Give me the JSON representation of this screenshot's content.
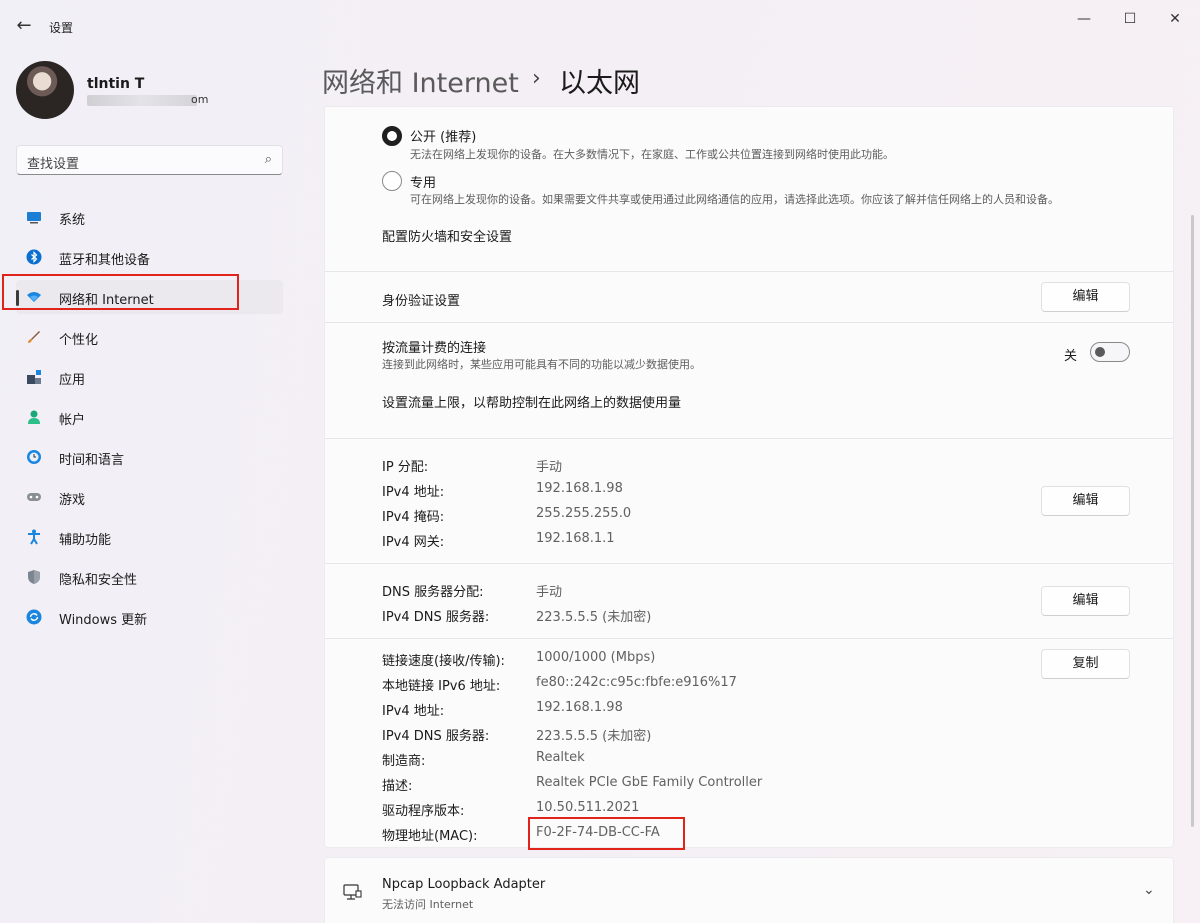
{
  "window": {
    "title": "设置",
    "minimize_glyph": "—",
    "maximize_glyph": "☐",
    "close_glyph": "✕"
  },
  "account": {
    "name": "tlntin T",
    "email_suffix": "om"
  },
  "search": {
    "placeholder": "查找设置"
  },
  "sidebar": {
    "items": [
      {
        "label": "系统",
        "icon": "system-icon"
      },
      {
        "label": "蓝牙和其他设备",
        "icon": "bluetooth-icon"
      },
      {
        "label": "网络和 Internet",
        "icon": "network-icon",
        "active": true
      },
      {
        "label": "个性化",
        "icon": "personalization-icon"
      },
      {
        "label": "应用",
        "icon": "apps-icon"
      },
      {
        "label": "帐户",
        "icon": "accounts-icon"
      },
      {
        "label": "时间和语言",
        "icon": "time-language-icon"
      },
      {
        "label": "游戏",
        "icon": "gaming-icon"
      },
      {
        "label": "辅助功能",
        "icon": "accessibility-icon"
      },
      {
        "label": "隐私和安全性",
        "icon": "privacy-icon"
      },
      {
        "label": "Windows 更新",
        "icon": "windows-update-icon"
      }
    ]
  },
  "header": {
    "parent": "网络和 Internet",
    "separator": "›",
    "current": "以太网"
  },
  "profile": {
    "public": {
      "label": "公开 (推荐)",
      "desc": "无法在网络上发现你的设备。在大多数情况下，在家庭、工作或公共位置连接到网络时使用此功能。",
      "selected": true
    },
    "private": {
      "label": "专用",
      "desc": "可在网络上发现你的设备。如果需要文件共享或使用通过此网络通信的应用，请选择此选项。你应该了解并信任网络上的人员和设备。",
      "selected": false
    },
    "firewall_link": "配置防火墙和安全设置"
  },
  "auth": {
    "label": "身份验证设置",
    "button": "编辑"
  },
  "metered": {
    "label": "按流量计费的连接",
    "desc": "连接到此网络时，某些应用可能具有不同的功能以减少数据使用。",
    "state": "关",
    "enabled": false,
    "limit_link": "设置流量上限，以帮助控制在此网络上的数据使用量"
  },
  "ip": {
    "button": "编辑",
    "rows": [
      {
        "label": "IP 分配:",
        "value": "手动"
      },
      {
        "label": "IPv4 地址:",
        "value": "192.168.1.98"
      },
      {
        "label": "IPv4 掩码:",
        "value": "255.255.255.0"
      },
      {
        "label": "IPv4 网关:",
        "value": "192.168.1.1"
      }
    ]
  },
  "dns": {
    "button": "编辑",
    "rows": [
      {
        "label": "DNS 服务器分配:",
        "value": "手动"
      },
      {
        "label": "IPv4 DNS 服务器:",
        "value": "223.5.5.5 (未加密)"
      }
    ]
  },
  "properties": {
    "button": "复制",
    "rows": [
      {
        "label": "链接速度(接收/传输):",
        "value": "1000/1000 (Mbps)"
      },
      {
        "label": "本地链接 IPv6 地址:",
        "value": "fe80::242c:c95c:fbfe:e916%17"
      },
      {
        "label": "IPv4 地址:",
        "value": "192.168.1.98"
      },
      {
        "label": "IPv4 DNS 服务器:",
        "value": "223.5.5.5 (未加密)"
      },
      {
        "label": "制造商:",
        "value": "Realtek"
      },
      {
        "label": "描述:",
        "value": "Realtek PCIe GbE Family Controller"
      },
      {
        "label": "驱动程序版本:",
        "value": "10.50.511.2021"
      },
      {
        "label": "物理地址(MAC):",
        "value": "F0-2F-74-DB-CC-FA"
      }
    ]
  },
  "adapter": {
    "name": "Npcap Loopback Adapter",
    "status": "无法访问 Internet"
  },
  "colors": {
    "highlight_box": "#e0241b",
    "accent": "#0067c0"
  }
}
